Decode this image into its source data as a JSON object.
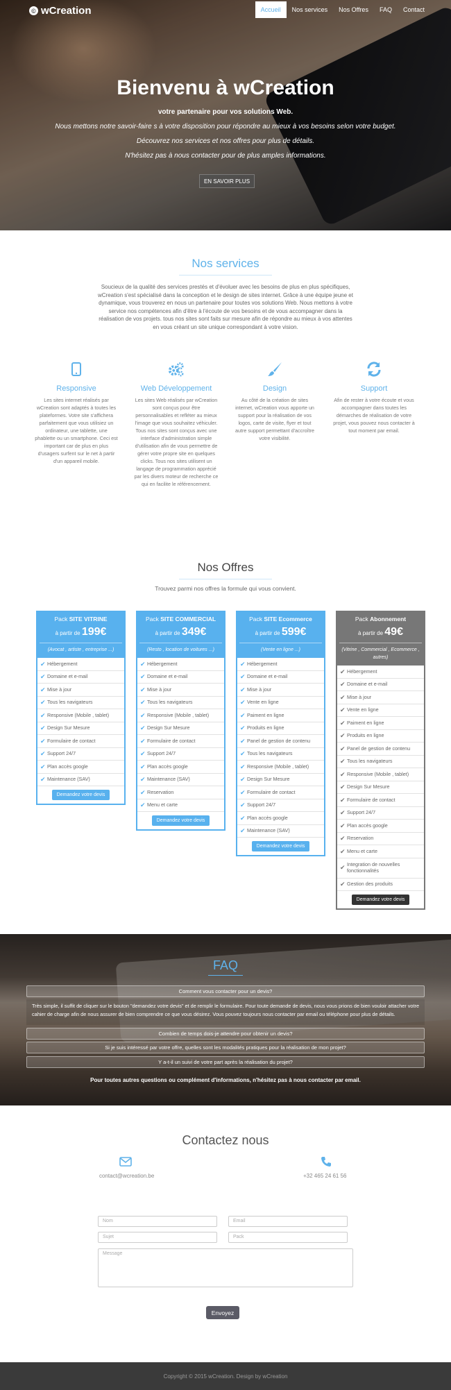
{
  "brand": {
    "name": "wCreation"
  },
  "nav": {
    "items": [
      "Accueil",
      "Nos services",
      "Nos Offres",
      "FAQ",
      "Contact"
    ]
  },
  "hero": {
    "title": "Bienvenu à wCreation",
    "subtitle": "votre partenaire pour vos solutions Web.",
    "line1": "Nous mettons notre savoir-faire s à votre disposition pour répondre au mieux à vos besoins selon votre budget.",
    "line2": "Découvrez nos services et nos offres pour plus de détails.",
    "line3": "N'hésitez pas à nous contacter pour de plus amples informations.",
    "cta": "EN SAVOIR PLUS"
  },
  "services": {
    "title": "Nos services",
    "intro": "Soucieux de la qualité des services prestés et d'évoluer avec les besoins de plus en plus spécifiques, wCreation s'est spécialisé dans la conception et le design de sites internet. Grâce à une équipe jeune et dynamique, vous trouverez en nous un partenaire pour toutes vos solutions Web. Nous mettons à votre service nos compétences afin d'être à l'écoute de vos besoins et de vous accompagner dans la réalisation de vos projets. tous nos sites sont faits sur mesure afin de répondre au mieux à vos attentes en vous créant un site unique correspondant à votre vision.",
    "items": [
      {
        "icon": "mobile-icon",
        "title": "Responsive",
        "text": "Les sites internet réalisés par wCreation sont adaptés à toutes les plateformes. Votre site s'affichera parfaitement que vous utilisiez un ordinateur, une tablette, une phablette ou un smartphone. Ceci est important car de plus en plus d'usagers surfent sur le net à partir d'un appareil mobile."
      },
      {
        "icon": "gears-icon",
        "title": "Web Développement",
        "text": "Les sites Web réalisés par wCreation sont conçus pour être personnalisables et refléter au mieux l'image que vous souhaitez véhiculer. Tous nos sites sont conçus avec une interface d'administration simple d'utilisation afin de vous permettre de gérer votre propre site en quelques clicks. Tous nos sites utilisent un langage de programmation apprécié par les divers moteur de recherche ce qui en facilite le référencement."
      },
      {
        "icon": "paintbrush-icon",
        "title": "Design",
        "text": "Au côté de la création de sites internet, wCreation vous apporte un support pour la réalisation de vos logos, carte de visite, flyer et tout autre support permettant d'accroître votre visibilité."
      },
      {
        "icon": "refresh-icon",
        "title": "Support",
        "text": "Afin de rester à votre écoute et vous accompagner dans toutes les démarches de réalisation de votre projet, vous pouvez nous contacter à tout moment par email."
      }
    ]
  },
  "offers": {
    "title": "Nos Offres",
    "subtitle": "Trouvez parmi nos offres la formule qui vous convient.",
    "price_prefix": "à partir de",
    "button": "Demandez votre devis",
    "cards": [
      {
        "pack": "Pack",
        "name": "SITE VITRINE",
        "price": "199€",
        "note": "(Avocat , artiste , entreprise ...)",
        "features": [
          "Hébergement",
          "Domaine et e-mail",
          "Mise à jour",
          "Tous les navigateurs",
          "Responsive (Mobile , tablet)",
          "Design Sur Mesure",
          "Formulaire de contact",
          "Support 24/7",
          "Plan accès google",
          "Maintenance (SAV)"
        ]
      },
      {
        "pack": "Pack",
        "name": "SITE COMMERCIAL",
        "price": "349€",
        "note": "(Resto , location de voitures ...)",
        "features": [
          "Hébergement",
          "Domaine et e-mail",
          "Mise à jour",
          "Tous les navigateurs",
          "Responsive (Mobile , tablet)",
          "Design Sur Mesure",
          "Formulaire de contact",
          "Support 24/7",
          "Plan accès google",
          "Maintenance (SAV)",
          "Reservation",
          "Menu et carte"
        ]
      },
      {
        "pack": "Pack",
        "name": "SITE Ecommerce",
        "price": "599€",
        "note": "(Vente en ligne ...)",
        "features": [
          "Hébergement",
          "Domaine et e-mail",
          "Mise à jour",
          "Vente en ligne",
          "Paiment en ligne",
          "Produits en ligne",
          "Panel de gestion de contenu",
          "Tous les navigateurs",
          "Responsive (Mobile , tablet)",
          "Design Sur Mesure",
          "Formulaire de contact",
          "Support 24/7",
          "Plan accès google",
          "Maintenance (SAV)"
        ]
      },
      {
        "pack": "Pack",
        "name": "Abonnement",
        "price": "49€",
        "note": "(Vitrine , Commercial , Ecommerce , autres)",
        "features": [
          "Hébergement",
          "Domaine et e-mail",
          "Mise à jour",
          "Vente en ligne",
          "Paiment en ligne",
          "Produits en ligne",
          "Panel de gestion de contenu",
          "Tous les navigateurs",
          "Responsive (Mobile , tablet)",
          "Design Sur Mesure",
          "Formulaire de contact",
          "Support 24/7",
          "Plan accès google",
          "Reservation",
          "Menu et carte",
          "Integration de nouvelles fonctionnalités",
          "Gestion des produits"
        ]
      }
    ]
  },
  "faq": {
    "title": "FAQ",
    "q1": "Comment vous contacter pour un devis?",
    "a1": "Très simple, il suffit de cliquer sur le bouton \"demandez votre devis\" et de remplir le formulaire. Pour toute demande de devis, nous vous prions de bien vouloir attacher votre cahier de charge afin de nous assurer de bien comprendre ce que vous désirez. Vous pouvez toujours nous contacter par email ou téléphone pour plus de détails.",
    "q2": "Combien de temps dois-je attendre pour obtenir un devis?",
    "q3": "Si je suis intéressé par votre offre, quelles sont les modalités pratiques pour la réalisation de mon projet?",
    "q4": "Y a-t-il un suivi de votre part après la réalisation du projet?",
    "footer": "Pour toutes autres questions ou complément d'informations, n'hésitez pas à nous contacter par email."
  },
  "contact": {
    "title": "Contactez nous",
    "email": "contact@wcreation.be",
    "phone": "+32 465 24 61 56",
    "placeholders": {
      "name": "Nom",
      "email": "Email",
      "subject": "Sujet",
      "pack": "Pack",
      "message": "Message"
    },
    "send": "Envoyez"
  },
  "footer": {
    "text": "Copyright © 2015 wCreation. Design by wCreation"
  }
}
